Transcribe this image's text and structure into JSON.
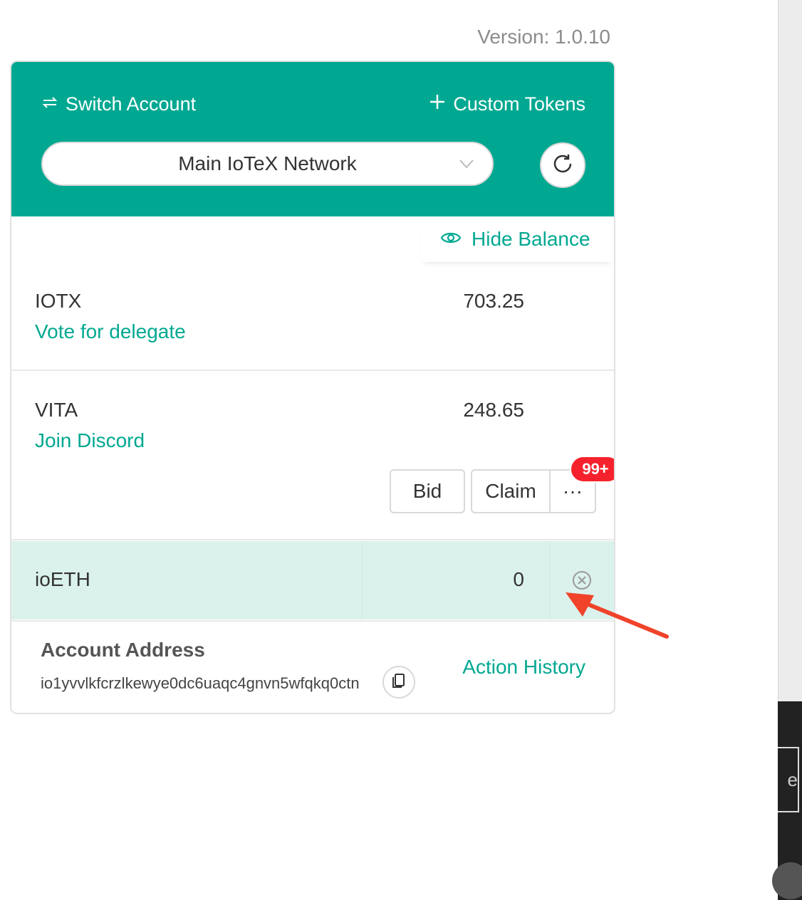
{
  "version": "Version: 1.0.10",
  "header": {
    "switch_account": "Switch Account",
    "custom_tokens": "Custom Tokens",
    "network": "Main IoTeX Network"
  },
  "hide_balance": "Hide Balance",
  "tokens": [
    {
      "symbol": "IOTX",
      "amount": "703.25",
      "link": "Vote for delegate"
    },
    {
      "symbol": "VITA",
      "amount": "248.65",
      "link": "Join Discord"
    },
    {
      "symbol": "ioETH",
      "amount": "0"
    }
  ],
  "vita_actions": {
    "bid": "Bid",
    "claim": "Claim",
    "more": "···",
    "badge": "99+"
  },
  "account": {
    "title": "Account Address",
    "address": "io1yvvlkfcrzlkewye0dc6uaqc4gnvn5wfqkq0ctn",
    "action_history": "Action History"
  },
  "side_text": "e",
  "colors": {
    "accent": "#00a891",
    "badge": "#f5222d",
    "highlight_row": "#dbf2ec",
    "arrow": "#f0432a"
  }
}
